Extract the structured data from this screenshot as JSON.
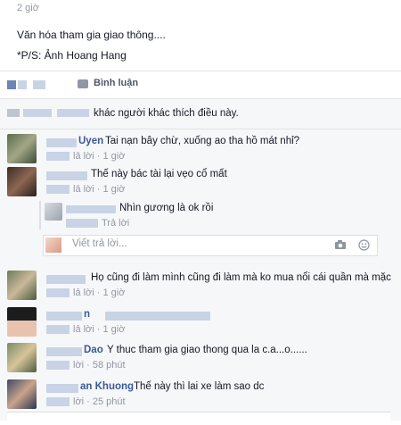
{
  "post": {
    "time": "2 giờ",
    "line1": "Văn hóa tham gia giao thông....",
    "line2": "*P/S: Ảnh Hoang Hang"
  },
  "actions": {
    "comment_label": "Bình luận"
  },
  "likes": {
    "text": "khác người khác thích điều này."
  },
  "comments": [
    {
      "name": "Uyen",
      "text": "Tai nạn bây chừ, xuống ao tha hồ mát nhỉ?",
      "time": "lả lời · 1 giờ"
    },
    {
      "name": "",
      "text": "Thế này bác tài lại vẹo cổ mất",
      "time": "lả lời · 1 giờ"
    },
    {
      "name": "",
      "text": "Nhìn gương là ok rồi",
      "time": "Trả lời"
    },
    {
      "name": "",
      "text": "Họ cũng đi làm mình cũng đi làm mà ko mua nổi cái quần mà mặc",
      "time": "lả lời · 1 giờ"
    },
    {
      "name": "n",
      "text": "",
      "time": "lả lời · 1 giờ"
    },
    {
      "name": "Dao",
      "text": "Y thuc tham gia giao thong qua la c.a...o......",
      "time": "lời · 58 phút"
    },
    {
      "name": "an Khuong",
      "text": "Thế này thì lai xe làm sao dc",
      "time": "lời · 25 phút"
    }
  ],
  "reply_box": {
    "placeholder": "Viết trả lời..."
  },
  "colors": {
    "link": "#3b5998",
    "meta": "#9197a3",
    "feedback_bg": "#f6f7f9"
  },
  "icons": [
    "thumb-icon",
    "comment-icon",
    "camera-icon",
    "smiley-icon"
  ]
}
